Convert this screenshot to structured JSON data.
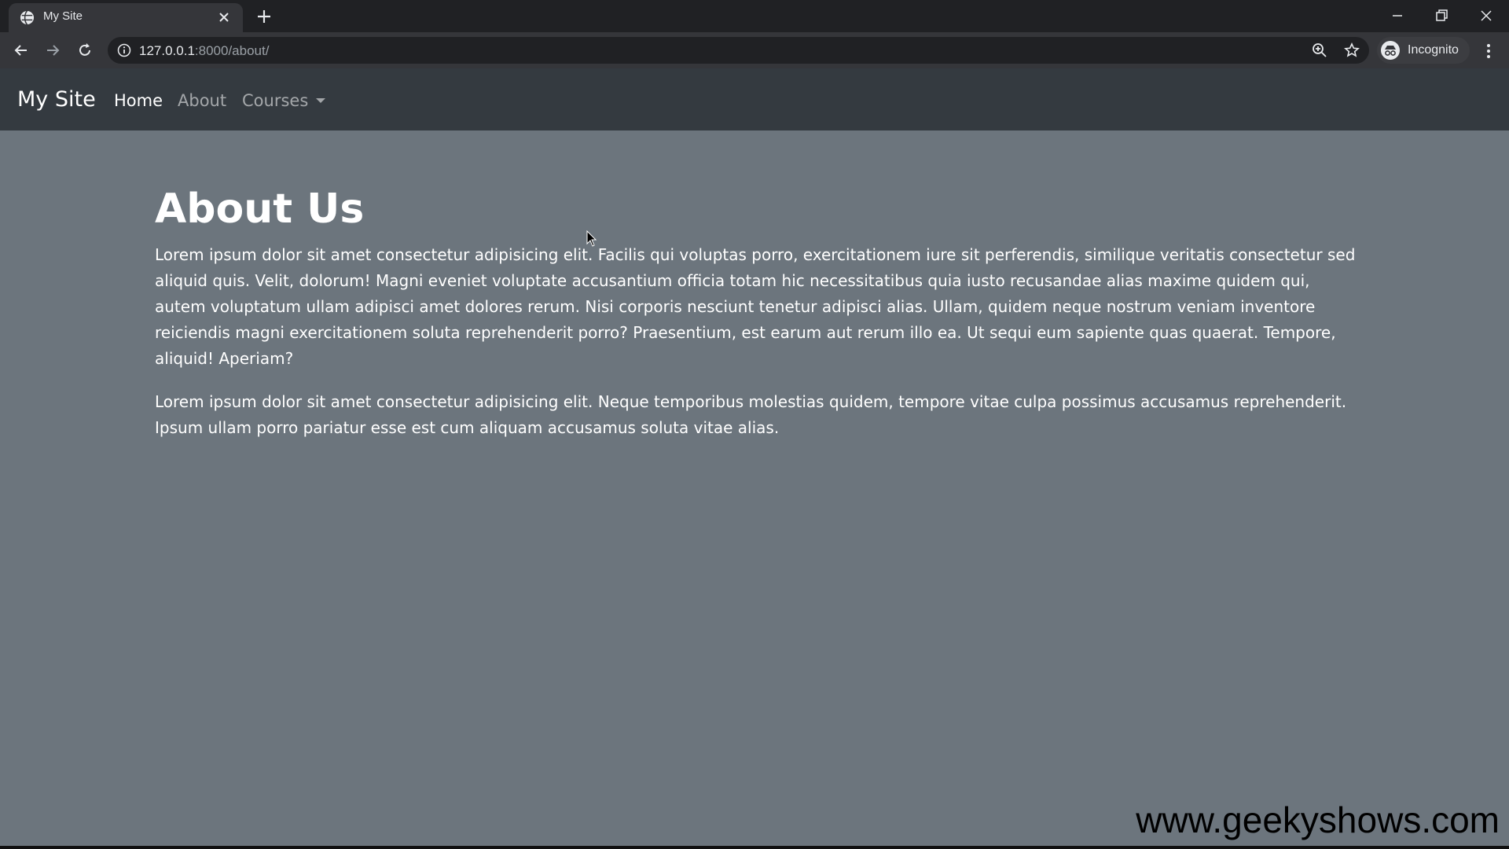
{
  "browser": {
    "tab_title": "My Site",
    "url_host": "127.0.0.1",
    "url_path": ":8000/about/",
    "incognito_label": "Incognito"
  },
  "navbar": {
    "brand": "My Site",
    "links": [
      {
        "label": "Home",
        "active": true
      },
      {
        "label": "About",
        "active": false
      },
      {
        "label": "Courses",
        "active": false
      }
    ]
  },
  "content": {
    "heading": "About Us",
    "paragraphs": [
      "Lorem ipsum dolor sit amet consectetur adipisicing elit. Facilis qui voluptas porro, exercitationem iure sit perferendis, similique veritatis consectetur sed aliquid quis. Velit, dolorum! Magni eveniet voluptate accusantium officia totam hic necessitatibus quia iusto recusandae alias maxime quidem qui, autem voluptatum ullam adipisci amet dolores rerum. Nisi corporis nesciunt tenetur adipisci alias. Ullam, quidem neque nostrum veniam inventore reiciendis magni exercitationem soluta reprehenderit porro? Praesentium, est earum aut rerum illo ea. Ut sequi eum sapiente quas quaerat. Tempore, aliquid! Aperiam?",
      "Lorem ipsum dolor sit amet consectetur adipisicing elit. Neque temporibus molestias quidem, tempore vitae culpa possimus accusamus reprehenderit. Ipsum ullam porro pariatur esse est cum aliquam accusamus soluta vitae alias."
    ]
  },
  "watermark": "www.geekyshows.com",
  "colors": {
    "page_bg": "#6c757d",
    "navbar_bg": "#343a40",
    "chrome_dark": "#202124",
    "chrome_toolbar": "#35363a"
  }
}
